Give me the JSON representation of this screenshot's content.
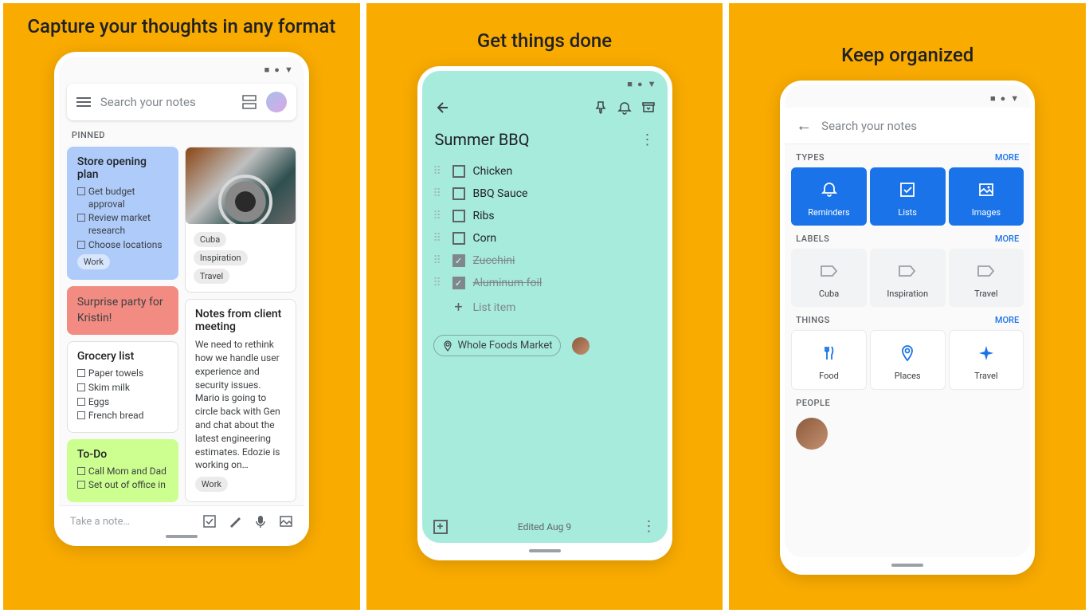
{
  "panel1": {
    "heading": "Capture your thoughts in any format",
    "search_placeholder": "Search your notes",
    "pinned_label": "PINNED",
    "cards": {
      "store_plan": {
        "title": "Store opening plan",
        "items": [
          "Get budget approval",
          "Review market research",
          "Choose locations"
        ],
        "chip": "Work"
      },
      "surprise": {
        "text": "Surprise party for Kristin!"
      },
      "grocery": {
        "title": "Grocery list",
        "items": [
          "Paper towels",
          "Skim milk",
          "Eggs",
          "French bread"
        ]
      },
      "todo": {
        "title": "To-Do",
        "items": [
          "Call Mom and Dad",
          "Set out of office in"
        ]
      },
      "image_card_chips": [
        "Cuba",
        "Inspiration",
        "Travel"
      ],
      "client": {
        "title": "Notes from client meeting",
        "body": "We need to rethink how we handle user experience and security issues. Mario is going to circle back with Gen and chat about the latest engineering estimates. Edozie is working on…",
        "chip": "Work"
      }
    },
    "take_note": "Take a note…"
  },
  "panel2": {
    "heading": "Get things done",
    "title": "Summer BBQ",
    "items": [
      {
        "text": "Chicken",
        "done": false
      },
      {
        "text": "BBQ Sauce",
        "done": false
      },
      {
        "text": "Ribs",
        "done": false
      },
      {
        "text": "Corn",
        "done": false
      },
      {
        "text": "Zucchini",
        "done": true
      },
      {
        "text": "Aluminum foil",
        "done": true
      }
    ],
    "list_item_placeholder": "List item",
    "location": "Whole Foods Market",
    "edited": "Edited Aug 9"
  },
  "panel3": {
    "heading": "Keep organized",
    "search_placeholder": "Search your notes",
    "more": "MORE",
    "sections": {
      "types": {
        "label": "TYPES",
        "tiles": [
          "Reminders",
          "Lists",
          "Images"
        ]
      },
      "labels": {
        "label": "LABELS",
        "tiles": [
          "Cuba",
          "Inspiration",
          "Travel"
        ]
      },
      "things": {
        "label": "THINGS",
        "tiles": [
          "Food",
          "Places",
          "Travel"
        ]
      },
      "people": {
        "label": "PEOPLE"
      }
    }
  }
}
